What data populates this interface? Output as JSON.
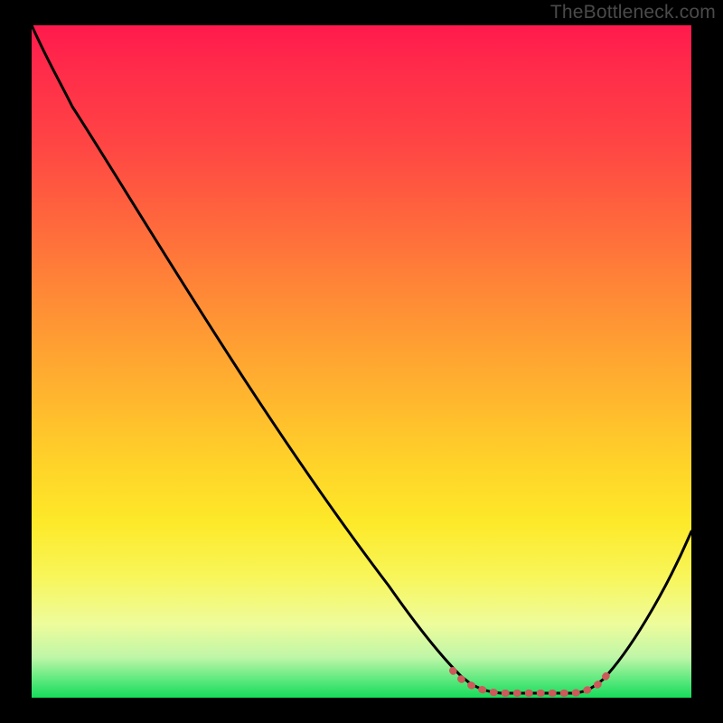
{
  "watermark": "TheBottleneck.com",
  "chart_data": {
    "type": "line",
    "title": "",
    "xlabel": "",
    "ylabel": "",
    "xlim": [
      0,
      100
    ],
    "ylim": [
      0,
      100
    ],
    "grid": false,
    "legend": false,
    "description": "Bottleneck curve over vertical performance-heatmap gradient (red=bad, green=good). Curve falls from top-left to a flat minimum near x≈68–83, then rises toward the right edge.",
    "gradient_stops": [
      {
        "pct": 0,
        "color": "#ff1a4d"
      },
      {
        "pct": 18,
        "color": "#ff4644"
      },
      {
        "pct": 42,
        "color": "#ff8f35"
      },
      {
        "pct": 65,
        "color": "#ffd229"
      },
      {
        "pct": 82,
        "color": "#f8f65a"
      },
      {
        "pct": 94,
        "color": "#bff6a8"
      },
      {
        "pct": 100,
        "color": "#16db5a"
      }
    ],
    "series": [
      {
        "name": "bottleneck-curve",
        "color": "#000000",
        "x": [
          0,
          4,
          8,
          12,
          18,
          24,
          30,
          36,
          42,
          48,
          54,
          60,
          63,
          66,
          70,
          74,
          78,
          82,
          85,
          88,
          92,
          96,
          100
        ],
        "y": [
          100,
          96,
          91,
          86,
          79,
          71,
          62,
          54,
          45,
          37,
          28,
          19,
          13,
          8,
          4,
          2,
          2,
          2,
          4,
          9,
          18,
          29,
          42
        ]
      },
      {
        "name": "minimum-band-marker",
        "color": "#cc5a5a",
        "x": [
          63,
          66,
          69,
          72,
          75,
          78,
          81,
          83,
          85
        ],
        "y": [
          7,
          4,
          3,
          2,
          2,
          2,
          2,
          3,
          5
        ]
      }
    ]
  }
}
